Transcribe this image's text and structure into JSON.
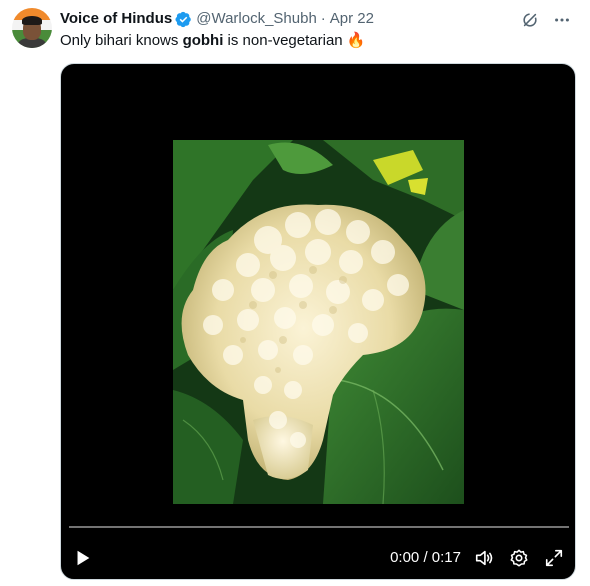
{
  "tweet": {
    "display_name": "Voice of Hindus",
    "verified": true,
    "handle": "@Warlock_Shubh",
    "separator": "·",
    "date": "Apr 22",
    "text_before": "Only bihari knows ",
    "text_bold": "gobhi",
    "text_after": " is non-vegetarian ",
    "emoji": "🔥"
  },
  "icons": {
    "verified": "verified-badge-icon",
    "grok": "grok-icon",
    "more": "more-horizontal-icon",
    "play": "play-icon",
    "volume": "volume-icon",
    "settings": "gear-icon",
    "fullscreen": "expand-icon"
  },
  "video": {
    "current_time": "0:00",
    "time_separator": " / ",
    "duration": "0:17",
    "progress_fraction": 0
  },
  "colors": {
    "text_primary": "#0f1419",
    "text_secondary": "#536471",
    "verified_blue": "#1d9bf0",
    "media_background": "#000000"
  }
}
